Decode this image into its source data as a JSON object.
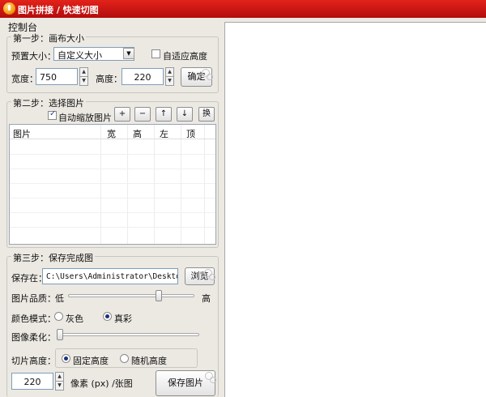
{
  "window": {
    "title": "图片拼接 / 快速切图"
  },
  "panel": {
    "title": "控制台"
  },
  "step1": {
    "legend": "第一步：画布大小",
    "preset_label": "预置大小：",
    "preset_value": "自定义大小",
    "adaptive_height_label": "自适应高度",
    "adaptive_height_checked": false,
    "width_label": "宽度：",
    "width_value": "750",
    "height_label": "高度：",
    "height_value": "220",
    "confirm_label": "确定"
  },
  "step2": {
    "legend": "第二步：选择图片",
    "auto_scale_label": "自动缩放图片",
    "auto_scale_checked": true,
    "toolbar": {
      "add": "+",
      "remove": "−",
      "up": "↑",
      "down": "↓",
      "swap": "换"
    },
    "columns": [
      "图片",
      "宽",
      "高",
      "左",
      "顶"
    ],
    "rows": []
  },
  "step3": {
    "legend": "第三步：保存完成图",
    "save_to_label": "保存在：",
    "save_path": "C:\\Users\\Administrator\\Desktop",
    "browse_label": "浏览",
    "quality_label": "图片品质：",
    "quality_low": "低",
    "quality_high": "高",
    "quality_level": 0.73,
    "color_mode_label": "颜色模式：",
    "gray_label": "灰色",
    "color_label": "真彩",
    "color_mode_selected": "color",
    "soften_label": "图像柔化：",
    "soften_level": 0.0,
    "slice_height_label": "切片高度：",
    "fixed_height_label": "固定高度",
    "random_height_label": "随机高度",
    "slice_mode_selected": "fixed",
    "pixel_value": "220",
    "pixel_unit_label": "像素 (px) /张图",
    "save_image_label": "保存图片"
  },
  "colors": {
    "titlebar": "#c8140f",
    "accent_check": "#2a4aa0",
    "canvas": "#ffffff"
  }
}
